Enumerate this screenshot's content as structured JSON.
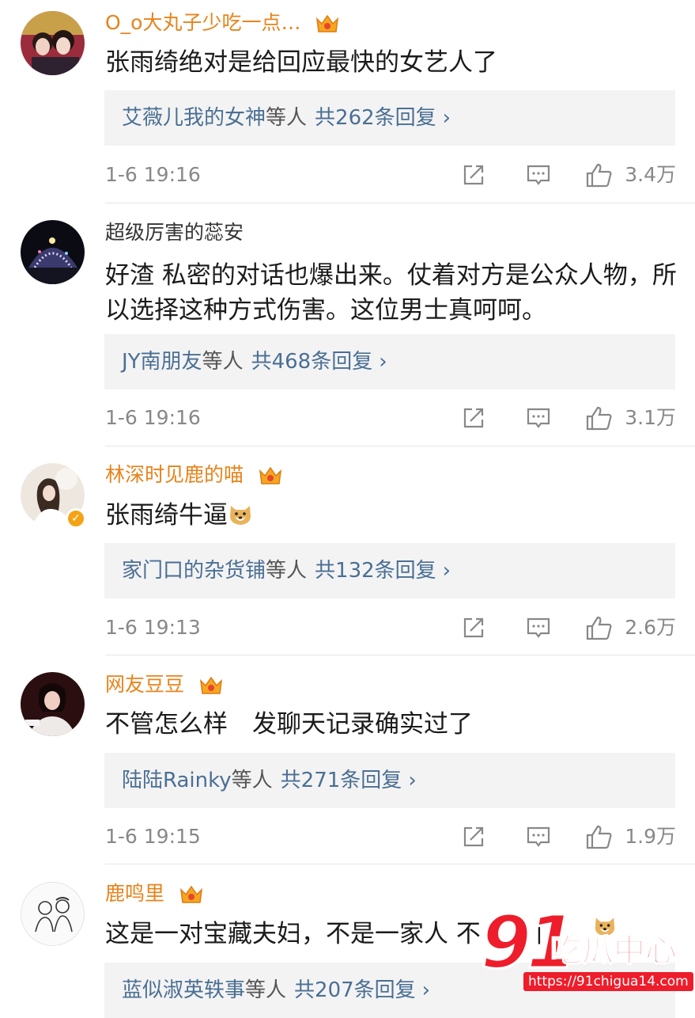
{
  "comments": [
    {
      "username": "O_o大丸子少吃一点…",
      "vip": true,
      "text": "张雨绮绝对是给回应最快的女艺人了",
      "reply_users": "艾薇儿我的女神",
      "reply_suffix": "等人",
      "reply_count": "共262条回复",
      "time": "1-6 19:16",
      "likes": "3.4万"
    },
    {
      "username": "超级厉害的蕊安",
      "vip": false,
      "text": "好渣 私密的对话也爆出来。仗着对方是公众人物，所以选择这种方式伤害。这位男士真呵呵。",
      "reply_users": "JY南朋友",
      "reply_suffix": "等人",
      "reply_count": "共468条回复",
      "time": "1-6 19:16",
      "likes": "3.1万"
    },
    {
      "username": "林深时见鹿的喵",
      "vip": true,
      "text": "张雨绮牛逼",
      "emoji": "doge-emoji",
      "verified": true,
      "reply_users": "家门口的杂货铺",
      "reply_suffix": "等人",
      "reply_count": "共132条回复",
      "time": "1-6 19:13",
      "likes": "2.6万"
    },
    {
      "username": "网友豆豆",
      "vip": true,
      "text": "不管怎么样　发聊天记录确实过了",
      "reply_users": "陆陆Rainky",
      "reply_suffix": "等人",
      "reply_count": "共271条回复",
      "time": "1-6 19:15",
      "likes": "1.9万"
    },
    {
      "username": "鹿鸣里",
      "vip": true,
      "text": "这是一对宝藏夫妇，不是一家人 不",
      "text_tail": "门",
      "reply_users": "蓝似淑英轶事",
      "reply_suffix": "等人",
      "reply_count": "共207条回复"
    }
  ],
  "icons": {
    "vip": "crown-badge-icon",
    "share": "share-icon",
    "comment": "comment-icon",
    "like": "thumbs-up-icon",
    "chevron": "chevron-right-icon",
    "chevron_char": "›"
  },
  "colors": {
    "vip_name": "#e8831b",
    "reply_link": "#4a6f94",
    "meta_gray": "#888888",
    "reply_bg": "#f3f3f3"
  },
  "watermark": {
    "number": "91",
    "name": "吃瓜中心",
    "url": "https://91chigua14.com"
  }
}
